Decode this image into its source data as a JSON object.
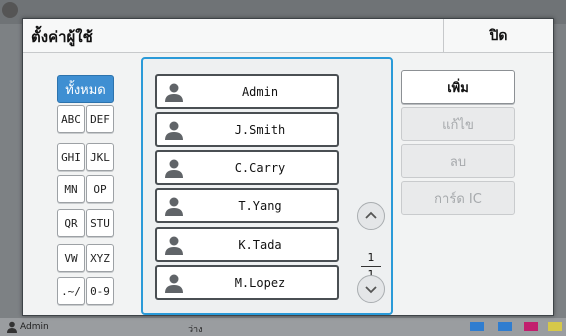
{
  "background": {
    "status_user": "Admin",
    "status_mid": "ว่าง"
  },
  "dialog": {
    "title": "ตั้งค่าผู้ใช้",
    "close_label": "ปิด"
  },
  "filters": {
    "all_label": "ทั้งหมด",
    "keys": [
      "ABC",
      "DEF",
      "GHI",
      "JKL",
      "MN",
      "OP",
      "QR",
      "STU",
      "VW",
      "XYZ",
      ".~/",
      "0-9"
    ]
  },
  "users": [
    "Admin",
    "J.Smith",
    "C.Carry",
    "T.Yang",
    "K.Tada",
    "M.Lopez"
  ],
  "pagination": {
    "current": "1",
    "total": "1"
  },
  "actions": {
    "add": "เพิ่ม",
    "edit": "แก้ไข",
    "delete": "ลบ",
    "ic_card": "การ์ด IC"
  },
  "colors": {
    "accent": "#3f8fd2",
    "list_border": "#2a9ad8"
  }
}
